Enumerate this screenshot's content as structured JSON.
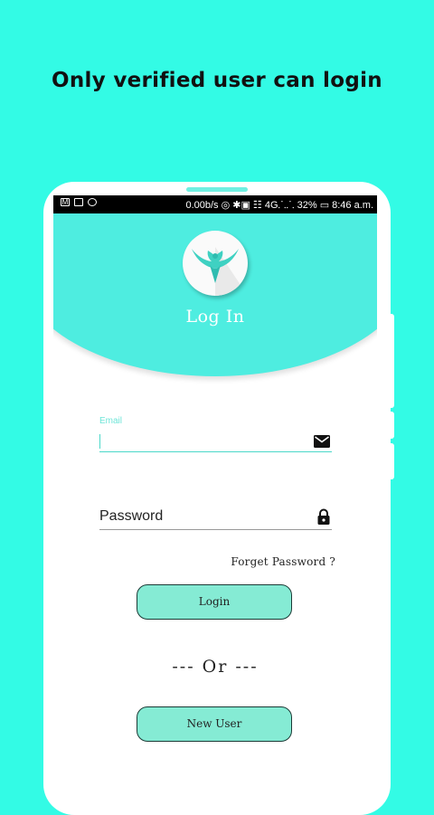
{
  "promo": {
    "headline": "Only verified user can login"
  },
  "status_bar": {
    "left_icons": [
      "gmail-icon",
      "gallery-icon",
      "whatsapp-icon"
    ],
    "right_text": "0.00b/s ◎ ✱▣ ☷ 4G⸫⸫ 32% ▭ 8:46 a.m."
  },
  "header": {
    "title": "Log In",
    "color": "#4eede0"
  },
  "form": {
    "email_label": "Email",
    "email_value": "",
    "password_placeholder": "Password",
    "forgot_label": "Forget Password ?",
    "login_label": "Login",
    "or_label": "--- Or ---",
    "new_user_label": "New User"
  },
  "colors": {
    "background": "#33fbe5",
    "header": "#4eede0",
    "button": "#85ebd4",
    "accent": "#4bd8c9"
  }
}
